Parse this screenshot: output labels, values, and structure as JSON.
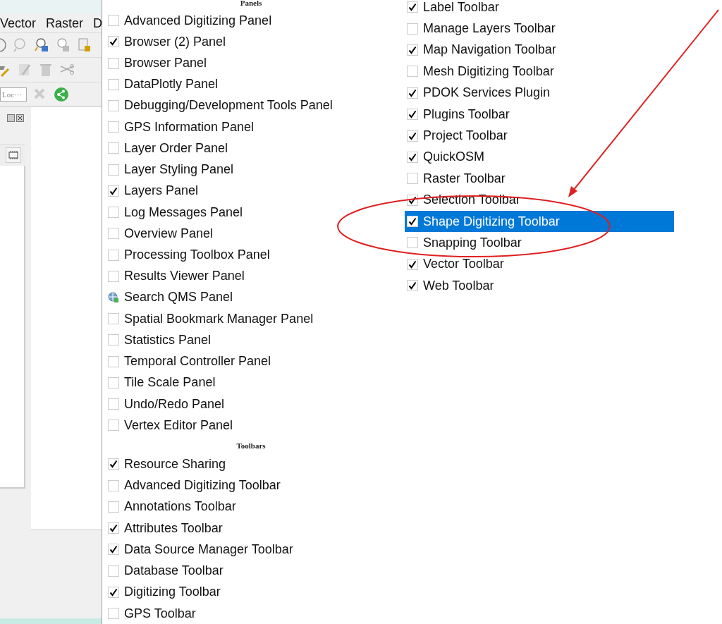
{
  "app_window": {
    "menus": [
      "Vector",
      "Raster",
      "D"
    ],
    "locator": {
      "placeholder": "Loc···"
    }
  },
  "menu": {
    "columns": [
      [
        {
          "kind": "header",
          "label": "Panels"
        },
        {
          "kind": "check",
          "label": "Advanced Digitizing Panel",
          "checked": false,
          "selected": false
        },
        {
          "kind": "check",
          "label": "Browser (2) Panel",
          "checked": true,
          "selected": false
        },
        {
          "kind": "check",
          "label": "Browser Panel",
          "checked": false,
          "selected": false
        },
        {
          "kind": "check",
          "label": "DataPlotly Panel",
          "checked": false,
          "selected": false
        },
        {
          "kind": "check",
          "label": "Debugging/Development Tools Panel",
          "checked": false,
          "selected": false
        },
        {
          "kind": "check",
          "label": "GPS Information Panel",
          "checked": false,
          "selected": false
        },
        {
          "kind": "check",
          "label": "Layer Order Panel",
          "checked": false,
          "selected": false
        },
        {
          "kind": "check",
          "label": "Layer Styling Panel",
          "checked": false,
          "selected": false
        },
        {
          "kind": "check",
          "label": "Layers Panel",
          "checked": true,
          "selected": false
        },
        {
          "kind": "check",
          "label": "Log Messages Panel",
          "checked": false,
          "selected": false
        },
        {
          "kind": "check",
          "label": "Overview Panel",
          "checked": false,
          "selected": false
        },
        {
          "kind": "check",
          "label": "Processing Toolbox Panel",
          "checked": false,
          "selected": false
        },
        {
          "kind": "check",
          "label": "Results Viewer Panel",
          "checked": false,
          "selected": false
        },
        {
          "kind": "icon",
          "label": "Search QMS Panel",
          "selected": false
        },
        {
          "kind": "check",
          "label": "Spatial Bookmark Manager Panel",
          "checked": false,
          "selected": false
        },
        {
          "kind": "check",
          "label": "Statistics Panel",
          "checked": false,
          "selected": false
        },
        {
          "kind": "check",
          "label": "Temporal Controller Panel",
          "checked": false,
          "selected": false
        },
        {
          "kind": "check",
          "label": "Tile Scale Panel",
          "checked": false,
          "selected": false
        },
        {
          "kind": "check",
          "label": "Undo/Redo Panel",
          "checked": false,
          "selected": false
        },
        {
          "kind": "check",
          "label": "Vertex Editor Panel",
          "checked": false,
          "selected": false
        },
        {
          "kind": "header",
          "label": "Toolbars"
        },
        {
          "kind": "check",
          "label": "Resource Sharing",
          "checked": true,
          "selected": false
        },
        {
          "kind": "check",
          "label": "Advanced Digitizing Toolbar",
          "checked": false,
          "selected": false
        },
        {
          "kind": "check",
          "label": "Annotations Toolbar",
          "checked": false,
          "selected": false
        },
        {
          "kind": "check",
          "label": "Attributes Toolbar",
          "checked": true,
          "selected": false
        },
        {
          "kind": "check",
          "label": "Data Source Manager Toolbar",
          "checked": true,
          "selected": false
        },
        {
          "kind": "check",
          "label": "Database Toolbar",
          "checked": false,
          "selected": false
        },
        {
          "kind": "check",
          "label": "Digitizing Toolbar",
          "checked": true,
          "selected": false
        },
        {
          "kind": "check",
          "label": "GPS Toolbar",
          "checked": false,
          "selected": false
        }
      ],
      [
        {
          "kind": "check",
          "label": "Label Toolbar",
          "checked": true,
          "selected": false
        },
        {
          "kind": "check",
          "label": "Manage Layers Toolbar",
          "checked": false,
          "selected": false
        },
        {
          "kind": "check",
          "label": "Map Navigation Toolbar",
          "checked": true,
          "selected": false
        },
        {
          "kind": "check",
          "label": "Mesh Digitizing Toolbar",
          "checked": false,
          "selected": false
        },
        {
          "kind": "check",
          "label": "PDOK Services Plugin",
          "checked": true,
          "selected": false
        },
        {
          "kind": "check",
          "label": "Plugins Toolbar",
          "checked": true,
          "selected": false
        },
        {
          "kind": "check",
          "label": "Project Toolbar",
          "checked": true,
          "selected": false
        },
        {
          "kind": "check",
          "label": "QuickOSM",
          "checked": true,
          "selected": false
        },
        {
          "kind": "check",
          "label": "Raster Toolbar",
          "checked": false,
          "selected": false
        },
        {
          "kind": "check",
          "label": "Selection Toolbar",
          "checked": true,
          "selected": false
        },
        {
          "kind": "check",
          "label": "Shape Digitizing Toolbar",
          "checked": true,
          "selected": true
        },
        {
          "kind": "check",
          "label": "Snapping Toolbar",
          "checked": false,
          "selected": false
        },
        {
          "kind": "check",
          "label": "Vector Toolbar",
          "checked": true,
          "selected": false
        },
        {
          "kind": "check",
          "label": "Web Toolbar",
          "checked": true,
          "selected": false
        }
      ]
    ]
  }
}
